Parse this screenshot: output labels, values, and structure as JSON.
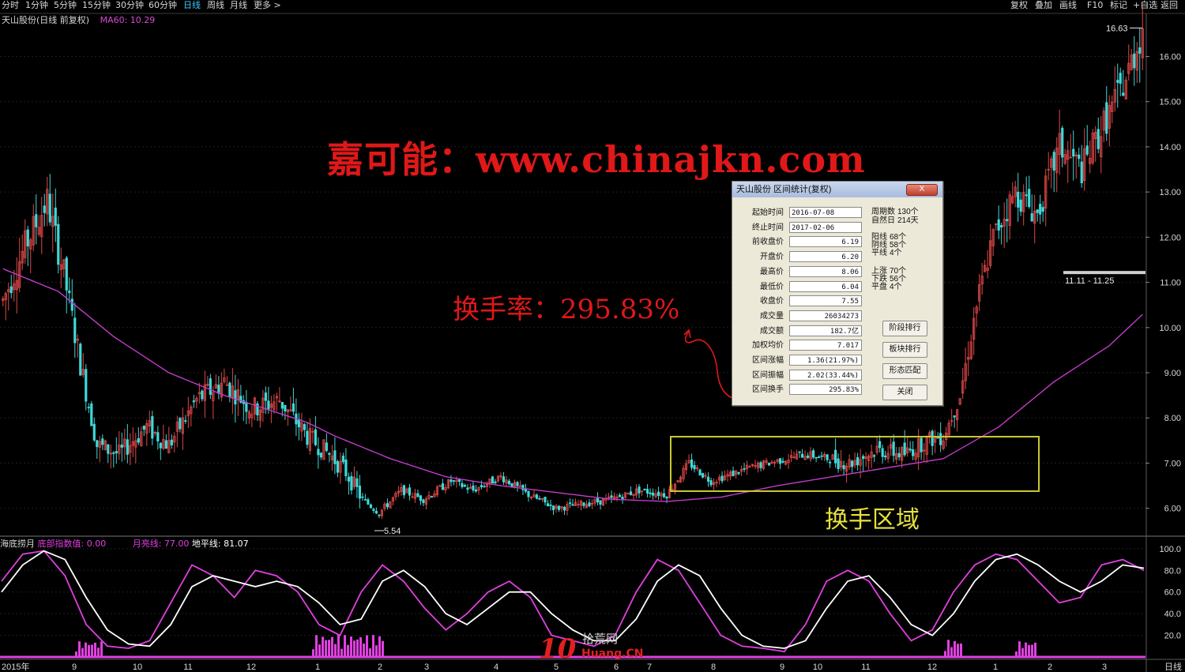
{
  "toolbar": {
    "left_items": [
      "分时",
      "1分钟",
      "5分钟",
      "15分钟",
      "30分钟",
      "60分钟",
      "日线",
      "周线",
      "月线",
      "更多 >"
    ],
    "active_index": 6,
    "right_items": [
      "复权",
      "叠加",
      "画线",
      "F10",
      "标记",
      "+自选",
      "返回"
    ]
  },
  "main_legend": {
    "stock": "天山股份(日线 前复权)",
    "ma": "MA60: 10.29",
    "ma_color": "#d84ad8"
  },
  "watermark": "嘉可能：www.chinajkn.com",
  "annotation": "换手率：295.83%",
  "region_label": "换手区域",
  "colors": {
    "up": "#e04848",
    "down": "#40d8d8",
    "ma60": "#c03cc8",
    "highlight_box": "#c8c832",
    "annotation": "#e01818",
    "osc_white": "#ffffff",
    "osc_magenta": "#e040e0"
  },
  "dialog": {
    "title": "天山股份 区间统计(复权)",
    "close_label": "X",
    "rows": [
      {
        "label": "起始时间",
        "value": "2016-07-08"
      },
      {
        "label": "终止时间",
        "value": "2017-02-06"
      },
      {
        "label": "前收盘价",
        "value": "6.19"
      },
      {
        "label": "开盘价",
        "value": "6.20"
      },
      {
        "label": "最高价",
        "value": "8.06"
      },
      {
        "label": "最低价",
        "value": "6.04"
      },
      {
        "label": "收盘价",
        "value": "7.55"
      },
      {
        "label": "成交量",
        "value": "26034273"
      },
      {
        "label": "成交额",
        "value": "182.7亿"
      },
      {
        "label": "加权均价",
        "value": "7.017"
      },
      {
        "label": "区间涨幅",
        "value": "1.36(21.97%)"
      },
      {
        "label": "区间振幅",
        "value": "2.02(33.44%)"
      },
      {
        "label": "区间换手",
        "value": "295.83%"
      }
    ],
    "stats": [
      {
        "label": "周期数",
        "value": "130个"
      },
      {
        "label": "自然日",
        "value": "214天"
      },
      {
        "label": "阳线",
        "value": "68个"
      },
      {
        "label": "阴线",
        "value": "58个"
      },
      {
        "label": "平线",
        "value": "4个"
      },
      {
        "label": "上涨",
        "value": "70个"
      },
      {
        "label": "下跌",
        "value": "56个"
      },
      {
        "label": "平盘",
        "value": "4个"
      }
    ],
    "buttons": [
      "阶段排行",
      "板块排行",
      "形态匹配",
      "关闭"
    ]
  },
  "sub_legend": {
    "name": "海底捞月",
    "item1": "底部指数值: 0.00",
    "item2": "月亮线: 77.00",
    "item3": "地平线: 81.07"
  },
  "logo": {
    "mark": "10",
    "line1": "拾荒网",
    "line2": "Huang.CN"
  },
  "chart_data": [
    {
      "type": "candlestick",
      "title": "天山股份(日线 前复权)",
      "y_ticks": [
        6.0,
        7.0,
        8.0,
        9.0,
        10.0,
        11.0,
        12.0,
        13.0,
        14.0,
        15.0,
        16.0
      ],
      "ylim": [
        5.4,
        16.9
      ],
      "x_ticks": [
        "2015年",
        "9",
        "10",
        "11",
        "12",
        "1",
        "2",
        "3",
        "4",
        "5",
        "6",
        "7",
        "8",
        "9",
        "10",
        "11",
        "12",
        "1",
        "2",
        "3"
      ],
      "x_label_right": "日线",
      "annotations": [
        {
          "text": "16.63",
          "price": 16.63
        },
        {
          "text": "5.54",
          "price": 5.54
        },
        {
          "text": "11.11 - 11.25",
          "price": 11.2
        }
      ],
      "ma60_label": "MA60: 10.29",
      "anchors": [
        [
          0,
          10.6
        ],
        [
          8,
          11.8
        ],
        [
          16,
          12.8
        ],
        [
          22,
          11.2
        ],
        [
          28,
          9.2
        ],
        [
          34,
          7.4
        ],
        [
          42,
          7.2
        ],
        [
          52,
          7.8
        ],
        [
          60,
          7.4
        ],
        [
          70,
          8.4
        ],
        [
          80,
          8.8
        ],
        [
          90,
          8.2
        ],
        [
          100,
          8.4
        ],
        [
          110,
          7.6
        ],
        [
          118,
          7.2
        ],
        [
          124,
          6.8
        ],
        [
          130,
          6.2
        ],
        [
          136,
          5.9
        ],
        [
          144,
          6.4
        ],
        [
          152,
          6.2
        ],
        [
          162,
          6.6
        ],
        [
          170,
          6.4
        ],
        [
          180,
          6.7
        ],
        [
          190,
          6.3
        ],
        [
          200,
          6.0
        ],
        [
          210,
          6.1
        ],
        [
          220,
          6.2
        ],
        [
          230,
          6.4
        ],
        [
          240,
          6.3
        ],
        [
          248,
          7.0
        ],
        [
          256,
          6.6
        ],
        [
          270,
          6.9
        ],
        [
          290,
          7.2
        ],
        [
          306,
          7.0
        ],
        [
          316,
          7.3
        ],
        [
          326,
          7.2
        ],
        [
          334,
          7.5
        ],
        [
          340,
          7.6
        ],
        [
          346,
          8.5
        ],
        [
          352,
          10.5
        ],
        [
          358,
          12.0
        ],
        [
          366,
          13.0
        ],
        [
          374,
          12.5
        ],
        [
          382,
          14.0
        ],
        [
          390,
          13.5
        ],
        [
          398,
          14.5
        ],
        [
          406,
          15.5
        ],
        [
          412,
          16.6
        ]
      ],
      "ma60_points": [
        [
          0,
          11.3
        ],
        [
          20,
          10.8
        ],
        [
          40,
          9.8
        ],
        [
          60,
          9.0
        ],
        [
          80,
          8.5
        ],
        [
          100,
          8.1
        ],
        [
          110,
          7.9
        ],
        [
          120,
          7.6
        ],
        [
          140,
          7.1
        ],
        [
          160,
          6.7
        ],
        [
          180,
          6.5
        ],
        [
          200,
          6.35
        ],
        [
          220,
          6.2
        ],
        [
          240,
          6.15
        ],
        [
          260,
          6.25
        ],
        [
          280,
          6.5
        ],
        [
          300,
          6.7
        ],
        [
          320,
          6.9
        ],
        [
          340,
          7.1
        ],
        [
          360,
          7.8
        ],
        [
          380,
          8.8
        ],
        [
          400,
          9.6
        ],
        [
          412,
          10.29
        ]
      ],
      "highlight_region": {
        "start": "2016-07-08",
        "end": "2017-02-06",
        "label": "换手区域"
      }
    },
    {
      "type": "line",
      "title": "海底捞月",
      "y_ticks": [
        20.0,
        40.0,
        60.0,
        80.0,
        100.0
      ],
      "ylim": [
        0,
        105
      ],
      "series": [
        {
          "name": "月亮线",
          "values": [
            70,
            95,
            98,
            75,
            30,
            10,
            8,
            15,
            50,
            85,
            75,
            55,
            80,
            75,
            60,
            30,
            20,
            60,
            85,
            70,
            45,
            25,
            40,
            60,
            70,
            55,
            20,
            15,
            10,
            20,
            60,
            90,
            80,
            50,
            20,
            10,
            8,
            5,
            30,
            70,
            80,
            70,
            40,
            15,
            25,
            60,
            85,
            95,
            90,
            70,
            50,
            55,
            85,
            90,
            80
          ]
        },
        {
          "name": "地平线",
          "values": [
            60,
            85,
            98,
            90,
            55,
            25,
            12,
            10,
            30,
            65,
            75,
            70,
            65,
            70,
            65,
            50,
            30,
            35,
            70,
            80,
            65,
            40,
            30,
            45,
            60,
            60,
            40,
            25,
            15,
            15,
            35,
            70,
            85,
            75,
            45,
            20,
            10,
            8,
            15,
            45,
            70,
            75,
            55,
            30,
            20,
            40,
            70,
            90,
            95,
            85,
            70,
            60,
            70,
            85,
            82
          ]
        }
      ],
      "bars_name": "底部指数值",
      "bars_current": 0.0
    }
  ]
}
